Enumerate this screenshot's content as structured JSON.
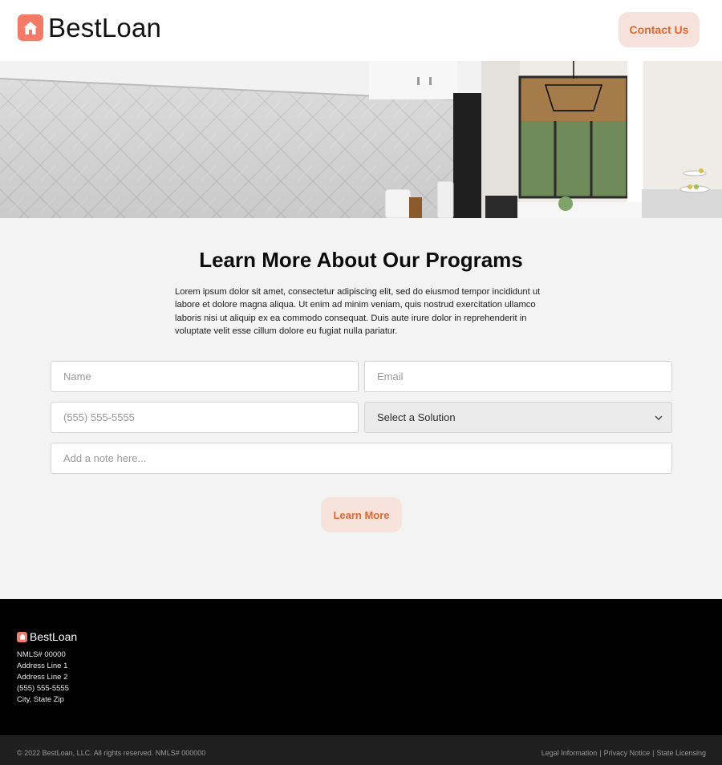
{
  "colors": {
    "accent": "#e8662a",
    "button_bg": "#f6e4dc",
    "logo": "#f47a66",
    "footer_bg": "#000000",
    "bottombar_bg": "#1f1f1f"
  },
  "header": {
    "logo_icon": "house-icon",
    "logo_text": "BestLoan",
    "contact_label": "Contact Us"
  },
  "hero": {
    "image": "kitchen-photo"
  },
  "main": {
    "title": "Learn More About Our Programs",
    "description": "Lorem ipsum dolor sit amet, consectetur adipiscing elit, sed do eiusmod tempor incididunt ut labore et dolore magna aliqua. Ut enim ad minim veniam, quis nostrud exercitation ullamco laboris nisi ut aliquip ex ea commodo consequat. Duis aute irure dolor in reprehenderit in voluptate velit esse cillum dolore eu fugiat nulla pariatur."
  },
  "form": {
    "name_placeholder": "Name",
    "email_placeholder": "Email",
    "phone_placeholder": "(555) 555-5555",
    "solution_selected": "Select a Solution",
    "note_placeholder": "Add a note here...",
    "submit_label": "Learn More"
  },
  "footer": {
    "logo_text": "BestLoan",
    "nmls": "NMLS# 00000",
    "address1": "Address Line 1",
    "address2": "Address Line 2",
    "phone": "(555) 555-5555",
    "city": "City, State Zip",
    "copyright": "© 2022 BestLoan, LLC. All rights reserved. NMLS# 000000",
    "links": [
      "Legal Information",
      "Privacy Notice",
      "State Licensing"
    ],
    "separator": "|"
  }
}
